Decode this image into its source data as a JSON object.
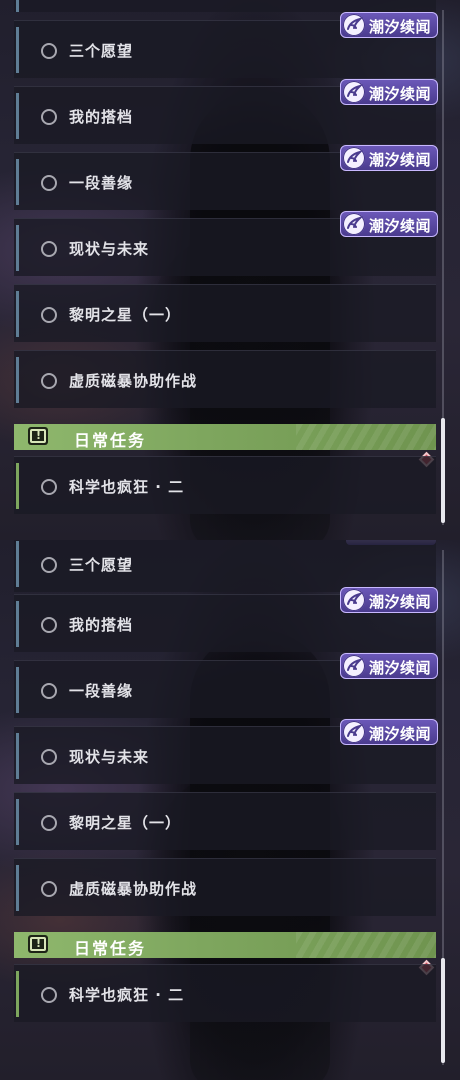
{
  "tag_label": "潮汐续闻",
  "panel_1": {
    "quests": [
      {
        "label": "三个愿望"
      },
      {
        "label": "我的搭档"
      },
      {
        "label": "一段善缘"
      },
      {
        "label": "现状与未来"
      },
      {
        "label": "黎明之星（一）"
      },
      {
        "label": "虚质磁暴协助作战"
      }
    ],
    "daily_header": "日常任务",
    "daily_quests": [
      {
        "label": "科学也疯狂 · 二"
      }
    ]
  },
  "panel_2": {
    "quests": [
      {
        "label": "三个愿望"
      },
      {
        "label": "我的搭档"
      },
      {
        "label": "一段善缘"
      },
      {
        "label": "现状与未来"
      },
      {
        "label": "黎明之星（一）"
      },
      {
        "label": "虚质磁暴协助作战"
      }
    ],
    "daily_header": "日常任务",
    "daily_quests": [
      {
        "label": "科学也疯狂 · 二"
      }
    ]
  },
  "colors": {
    "tag_purple": "#5a49a6",
    "daily_green": "#8fb86d",
    "row_accent": "#5f7d95",
    "alert_red": "#d14a58"
  },
  "icons": {
    "quest_status": "circle-outline-icon",
    "tag": "tide-swirl-icon",
    "daily": "alert-box-icon",
    "alert": "diamond-alert-icon"
  }
}
